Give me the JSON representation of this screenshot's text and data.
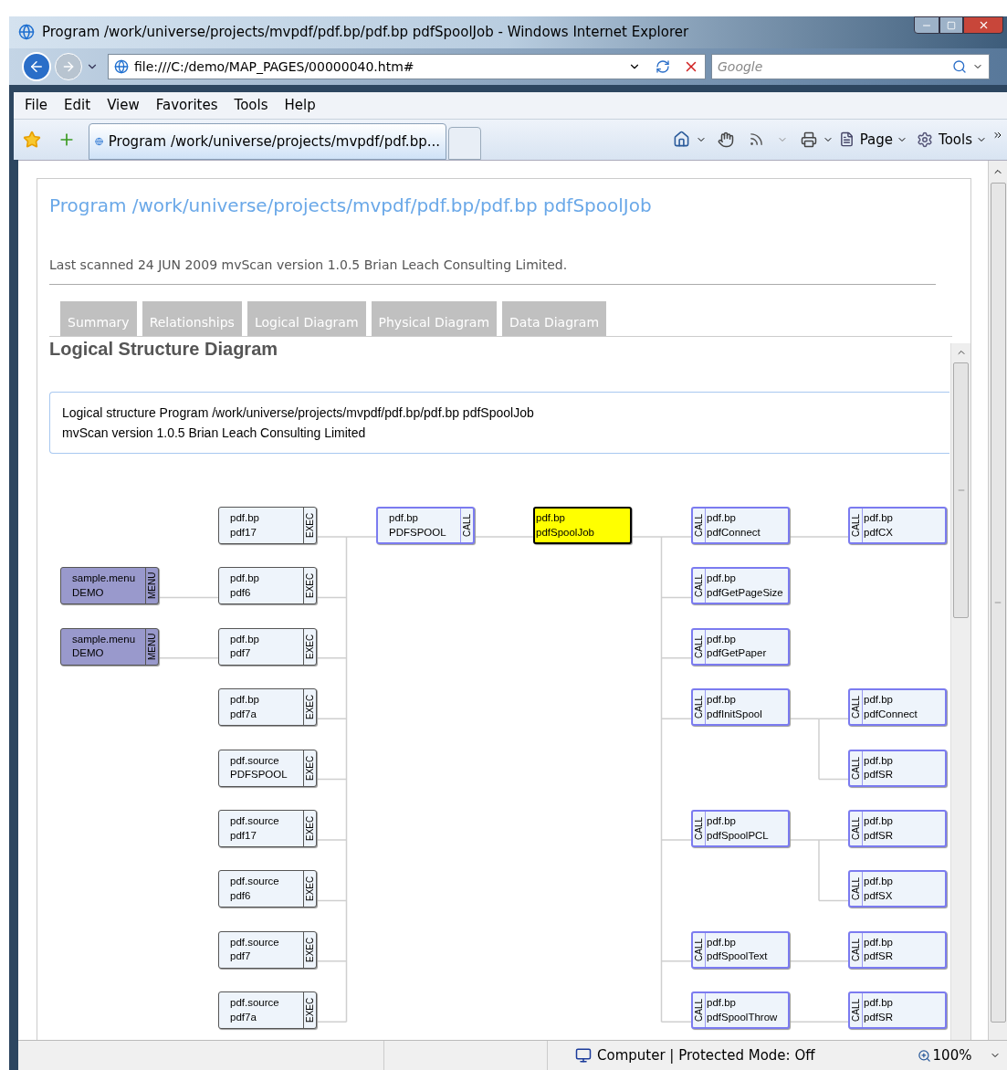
{
  "window": {
    "title": "Program /work/universe/projects/mvpdf/pdf.bp/pdf.bp pdfSpoolJob - Windows Internet Explorer"
  },
  "address_bar": {
    "url": "file:///C:/demo/MAP_PAGES/00000040.htm#",
    "search_placeholder": "Google"
  },
  "menu": [
    "File",
    "Edit",
    "View",
    "Favorites",
    "Tools",
    "Help"
  ],
  "browser_tab": {
    "title": "Program /work/universe/projects/mvpdf/pdf.bp..."
  },
  "command_bar": [
    "Page",
    "Tools"
  ],
  "page": {
    "title": "Program /work/universe/projects/mvpdf/pdf.bp/pdf.bp pdfSpoolJob",
    "scanned": "Last scanned 24 JUN 2009 mvScan version 1.0.5 Brian Leach Consulting Limited.",
    "tabs": [
      "Summary",
      "Relationships",
      "Logical Diagram",
      "Physical Diagram",
      "Data Diagram"
    ],
    "heading": "Logical Structure Diagram",
    "description": [
      "Logical structure Program /work/universe/projects/mvpdf/pdf.bp/pdf.bp pdfSpoolJob",
      "mvScan version 1.0.5 Brian Leach Consulting Limited"
    ]
  },
  "diagram": {
    "root": {
      "library": "pdf.bp",
      "name": "pdfSpoolJob",
      "kind": "current"
    },
    "callers": [
      {
        "library": "pdf.bp",
        "name": "PDFSPOOL",
        "kind": "call",
        "tag": "CALL",
        "children": [
          {
            "library": "pdf.bp",
            "name": "pdf17",
            "kind": "exec",
            "tag": "EXEC"
          },
          {
            "library": "pdf.bp",
            "name": "pdf6",
            "kind": "exec",
            "tag": "EXEC",
            "children": [
              {
                "library": "sample.menu",
                "name": "DEMO",
                "kind": "menu",
                "tag": "MENU"
              }
            ]
          },
          {
            "library": "pdf.bp",
            "name": "pdf7",
            "kind": "exec",
            "tag": "EXEC",
            "children": [
              {
                "library": "sample.menu",
                "name": "DEMO",
                "kind": "menu",
                "tag": "MENU"
              }
            ]
          },
          {
            "library": "pdf.bp",
            "name": "pdf7a",
            "kind": "exec",
            "tag": "EXEC"
          },
          {
            "library": "pdf.source",
            "name": "PDFSPOOL",
            "kind": "exec",
            "tag": "EXEC"
          },
          {
            "library": "pdf.source",
            "name": "pdf17",
            "kind": "exec",
            "tag": "EXEC"
          },
          {
            "library": "pdf.source",
            "name": "pdf6",
            "kind": "exec",
            "tag": "EXEC"
          },
          {
            "library": "pdf.source",
            "name": "pdf7",
            "kind": "exec",
            "tag": "EXEC"
          },
          {
            "library": "pdf.source",
            "name": "pdf7a",
            "kind": "exec",
            "tag": "EXEC"
          }
        ]
      }
    ],
    "callees": [
      {
        "library": "pdf.bp",
        "name": "pdfConnect",
        "kind": "call",
        "tag": "CALL",
        "children": [
          {
            "library": "pdf.bp",
            "name": "pdfCX",
            "kind": "call",
            "tag": "CALL"
          }
        ]
      },
      {
        "library": "pdf.bp",
        "name": "pdfGetPageSize",
        "kind": "call",
        "tag": "CALL"
      },
      {
        "library": "pdf.bp",
        "name": "pdfGetPaper",
        "kind": "call",
        "tag": "CALL"
      },
      {
        "library": "pdf.bp",
        "name": "pdfInitSpool",
        "kind": "call",
        "tag": "CALL",
        "children": [
          {
            "library": "pdf.bp",
            "name": "pdfConnect",
            "kind": "call",
            "tag": "CALL"
          },
          {
            "library": "pdf.bp",
            "name": "pdfSR",
            "kind": "call",
            "tag": "CALL"
          }
        ]
      },
      {
        "library": "pdf.bp",
        "name": "pdfSpoolPCL",
        "kind": "call",
        "tag": "CALL",
        "children": [
          {
            "library": "pdf.bp",
            "name": "pdfSR",
            "kind": "call",
            "tag": "CALL"
          },
          {
            "library": "pdf.bp",
            "name": "pdfSX",
            "kind": "call",
            "tag": "CALL"
          }
        ]
      },
      {
        "library": "pdf.bp",
        "name": "pdfSpoolText",
        "kind": "call",
        "tag": "CALL",
        "children": [
          {
            "library": "pdf.bp",
            "name": "pdfSR",
            "kind": "call",
            "tag": "CALL"
          }
        ]
      },
      {
        "library": "pdf.bp",
        "name": "pdfSpoolThrow",
        "kind": "call",
        "tag": "CALL",
        "children": [
          {
            "library": "pdf.bp",
            "name": "pdfSR",
            "kind": "call",
            "tag": "CALL"
          }
        ]
      }
    ]
  },
  "status_bar": {
    "zone": "Computer | Protected Mode: Off",
    "zoom": "100%"
  }
}
